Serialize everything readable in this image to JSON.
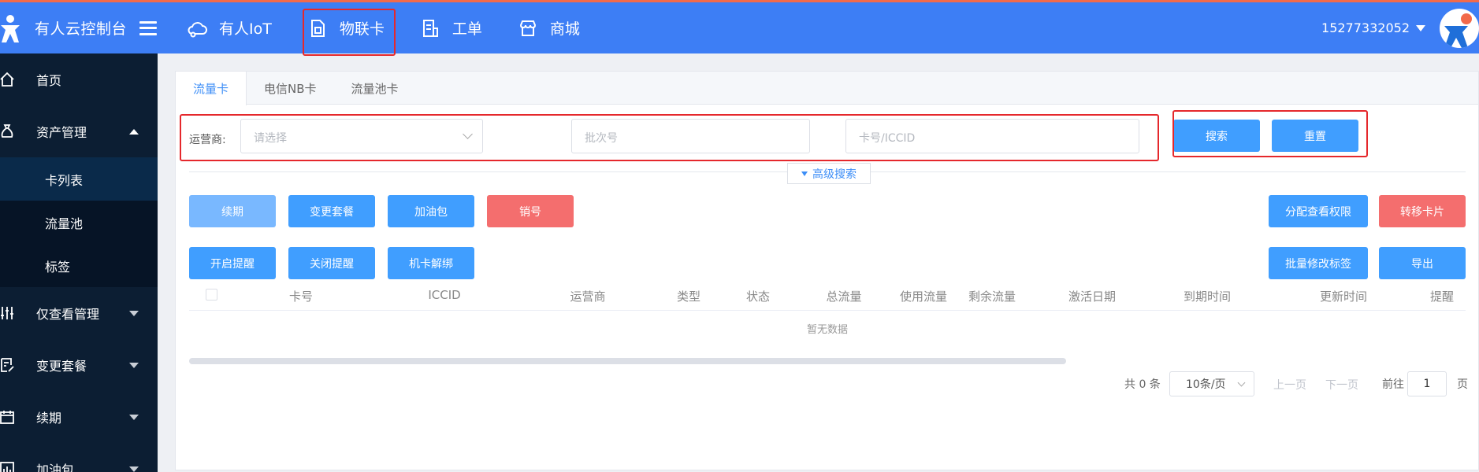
{
  "app": {
    "title": "有人云控制台",
    "user": "15277332052"
  },
  "topnav": [
    {
      "label": "有人IoT",
      "icon": "cloud-icon"
    },
    {
      "label": "物联卡",
      "icon": "sim-card-icon"
    },
    {
      "label": "工单",
      "icon": "ticket-icon"
    },
    {
      "label": "商城",
      "icon": "shop-icon"
    }
  ],
  "sidebar": {
    "home": "首页",
    "assets": "资产管理",
    "assets_sub": [
      "卡列表",
      "流量池",
      "标签"
    ],
    "view_mgmt": "仅查看管理",
    "change_plan": "变更套餐",
    "renew": "续期",
    "addon": "加油包"
  },
  "tabs": [
    "流量卡",
    "电信NB卡",
    "流量池卡"
  ],
  "filter": {
    "operator_label": "运营商:",
    "operator_placeholder": "请选择",
    "batch_placeholder": "批次号",
    "card_placeholder": "卡号/ICCID",
    "search": "搜索",
    "reset": "重置",
    "advanced": "高级搜索"
  },
  "actions": {
    "renew": "续期",
    "change_plan": "变更套餐",
    "addon": "加油包",
    "cancel": "销号",
    "assign_view": "分配查看权限",
    "transfer": "转移卡片",
    "open_alert": "开启提醒",
    "close_alert": "关闭提醒",
    "unbind": "机卡解绑",
    "batch_tag": "批量修改标签",
    "export": "导出"
  },
  "table": {
    "columns": [
      "卡号",
      "ICCID",
      "运营商",
      "类型",
      "状态",
      "总流量",
      "使用流量",
      "剩余流量",
      "激活日期",
      "到期时间",
      "更新时间",
      "提醒"
    ],
    "empty": "暂无数据"
  },
  "pagination": {
    "total": "共 0 条",
    "page_size": "10条/页",
    "prev": "上一页",
    "next": "下一页",
    "goto": "前往",
    "page": "1",
    "page_unit": "页"
  },
  "colors": {
    "primary": "#3d7ef5",
    "sidebar": "#0c1e33",
    "danger": "#f46e6e",
    "highlight": "#e5282c"
  }
}
